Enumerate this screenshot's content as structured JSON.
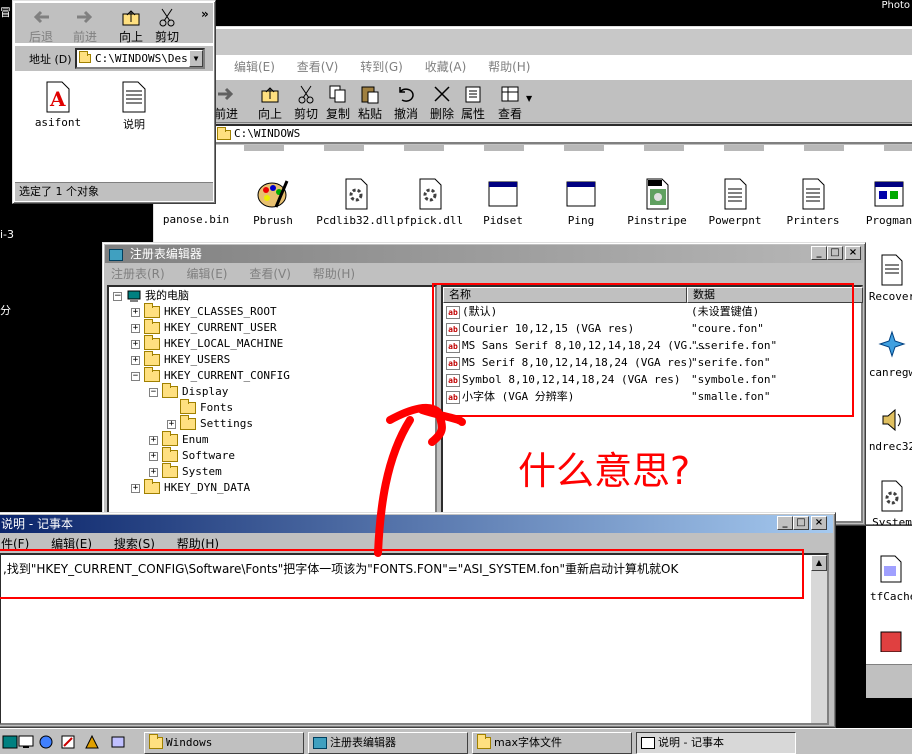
{
  "corner_text": "Photo",
  "desktop_edge": {
    "a": "冒",
    "b": "i-3",
    "c": "分"
  },
  "explorer_small": {
    "toolbar": {
      "back": "后退",
      "forward": "前进",
      "up": "向上",
      "cut": "剪切"
    },
    "address_label": "地址 (D)",
    "address_value": "C:\\WINDOWS\\Des",
    "files": [
      "asifont",
      "说明"
    ],
    "status": "选定了 1 个对象"
  },
  "explorer_big": {
    "menu": [
      "编辑(E)",
      "查看(V)",
      "转到(G)",
      "收藏(A)",
      "帮助(H)"
    ],
    "toolbar": {
      "forward": "前进",
      "up": "向上",
      "cut": "剪切",
      "copy": "复制",
      "paste": "粘贴",
      "undo": "撤消",
      "delete": "删除",
      "props": "属性",
      "view": "查看"
    },
    "address_value": "C:\\WINDOWS",
    "files": [
      "panose.bin",
      "Pbrush",
      "Pcdlib32.dll",
      "pfpick.dll",
      "Pidset",
      "Ping",
      "Pinstripe",
      "Powerpnt",
      "Printers",
      "Progman"
    ],
    "right_files": [
      "Recover",
      "canregw",
      "ndrec32",
      "System",
      "tfCache"
    ],
    "colors": {
      "address_bg": "#ffffff"
    }
  },
  "regedit": {
    "title": "注册表编辑器",
    "menu": [
      "注册表(R)",
      "编辑(E)",
      "查看(V)",
      "帮助(H)"
    ],
    "tree": {
      "root": "我的电脑",
      "keys": [
        "HKEY_CLASSES_ROOT",
        "HKEY_CURRENT_USER",
        "HKEY_LOCAL_MACHINE",
        "HKEY_USERS",
        "HKEY_CURRENT_CONFIG"
      ],
      "display": "Display",
      "fonts": "Fonts",
      "settings": "Settings",
      "sub": [
        "Enum",
        "Software",
        "System"
      ],
      "dyn": "HKEY_DYN_DATA"
    },
    "list": {
      "col_name": "名称",
      "col_data": "数据",
      "rows": [
        {
          "name": "(默认)",
          "data": "(未设置键值)"
        },
        {
          "name": "Courier 10,12,15 (VGA res)",
          "data": "\"coure.fon\""
        },
        {
          "name": "MS Sans Serif 8,10,12,14,18,24 (VG...",
          "data": "\"sserife.fon\""
        },
        {
          "name": "MS Serif 8,10,12,14,18,24 (VGA res)",
          "data": "\"serife.fon\""
        },
        {
          "name": "Symbol 8,10,12,14,18,24 (VGA res)",
          "data": "\"symbole.fon\""
        },
        {
          "name": "小字体 (VGA 分辨率)",
          "data": "\"smalle.fon\""
        }
      ]
    }
  },
  "annotation": {
    "question": "什么意思?",
    "color": "#ff0000"
  },
  "notepad": {
    "title": "说明 - 记事本",
    "menu": [
      "件(F)",
      "编辑(E)",
      "搜索(S)",
      "帮助(H)"
    ],
    "text": ",找到\"HKEY_CURRENT_CONFIG\\Software\\Fonts\"把字体一项该为\"FONTS.FON\"=\"ASI_SYSTEM.fon\"重新启动计算机就OK"
  },
  "taskbar": {
    "tasks": [
      "Windows",
      "注册表编辑器",
      "max字体文件",
      "说明 - 记事本"
    ]
  }
}
